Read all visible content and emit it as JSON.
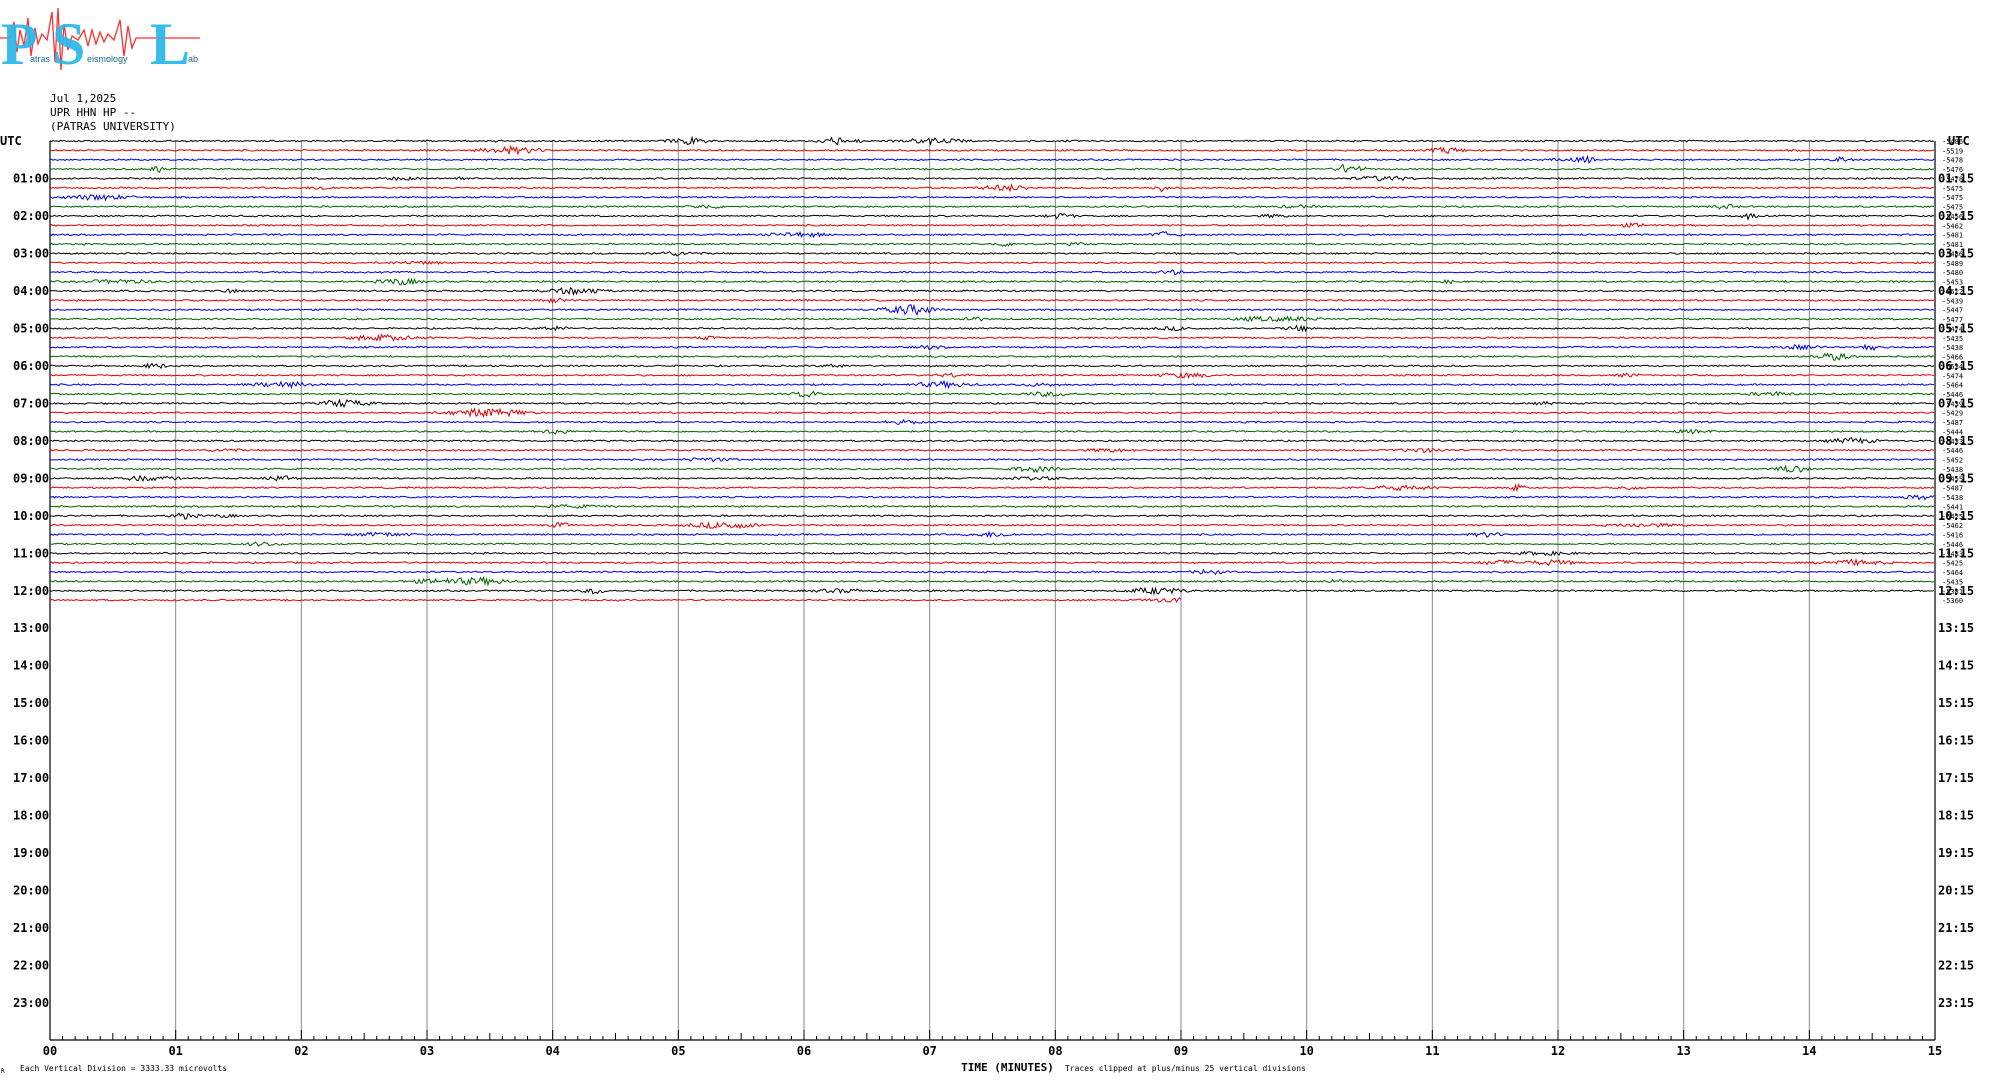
{
  "logo": {
    "letters": [
      "P",
      "S",
      "L"
    ],
    "words": [
      "atras",
      "eismology",
      "ab"
    ],
    "colors": {
      "letters": "#29b6e8",
      "seismic": "#ff2f2f",
      "words": "#1a6f94"
    }
  },
  "header": {
    "date": "Jul 1,2025",
    "station": "UPR HHN HP --",
    "institution": "(PATRAS UNIVERSITY)"
  },
  "chart_data": {
    "type": "line",
    "title": "Jul 1,2025 UPR HHN HP --",
    "left_axis_label": "UTC",
    "right_axis_label": "UTC",
    "xlabel": "TIME (MINUTES)",
    "xlim": [
      0,
      15
    ],
    "x_ticks": [
      "00",
      "01",
      "02",
      "03",
      "04",
      "05",
      "06",
      "07",
      "08",
      "09",
      "10",
      "11",
      "12",
      "13",
      "14",
      "15"
    ],
    "minutes_per_line": 15,
    "lines_per_hour": 4,
    "hour_labels_left": [
      "01:00",
      "02:00",
      "03:00",
      "04:00",
      "05:00",
      "06:00",
      "07:00",
      "08:00",
      "09:00",
      "10:00",
      "11:00",
      "12:00",
      "13:00",
      "14:00",
      "15:00",
      "16:00",
      "17:00",
      "18:00",
      "19:00",
      "20:00",
      "21:00",
      "22:00",
      "23:00"
    ],
    "hour_labels_right": [
      "01:15",
      "02:15",
      "03:15",
      "04:15",
      "05:15",
      "06:15",
      "07:15",
      "08:15",
      "09:15",
      "10:15",
      "11:15",
      "12:15",
      "13:15",
      "14:15",
      "15:15",
      "16:15",
      "17:15",
      "18:15",
      "19:15",
      "20:15",
      "21:15",
      "22:15",
      "23:15"
    ],
    "trace_colors": [
      "#000000",
      "#e00000",
      "#0000e0",
      "#006400"
    ],
    "trace_offsets": [
      -5486,
      -5519,
      -5478,
      -5476,
      -5478,
      -5475,
      -5475,
      -5475,
      -5456,
      -5462,
      -5481,
      -5481,
      -5486,
      -5489,
      -5480,
      -5453,
      -5512,
      -5439,
      -5447,
      -5477,
      -5474,
      -5435,
      -5438,
      -5466,
      -5534,
      -5474,
      -5464,
      -5446,
      -5439,
      -5429,
      -5487,
      -5444,
      -5433,
      -5446,
      -5452,
      -5438,
      -5455,
      -5487,
      -5438,
      -5441,
      -5425,
      -5462,
      -5416,
      -5446,
      -5483,
      -5425,
      -5464,
      -5435,
      -5381,
      -5360
    ],
    "last_trace_end_minute": 9.0,
    "scale_note": "Each Vertical Division = 3333.33 microvolts",
    "clip_note": "Traces clipped at plus/minus 25 vertical divisions",
    "corner_mark": "R"
  }
}
